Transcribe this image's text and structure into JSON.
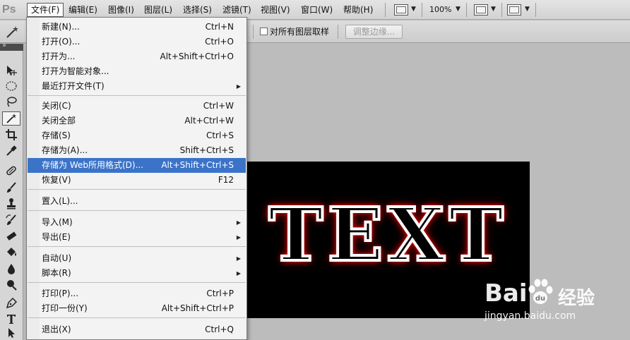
{
  "app": {
    "logo": "Ps"
  },
  "menubar": {
    "items": [
      {
        "label": "文件(F)"
      },
      {
        "label": "编辑(E)"
      },
      {
        "label": "图像(I)"
      },
      {
        "label": "图层(L)"
      },
      {
        "label": "选择(S)"
      },
      {
        "label": "滤镜(T)"
      },
      {
        "label": "视图(V)"
      },
      {
        "label": "窗口(W)"
      },
      {
        "label": "帮助(H)"
      }
    ],
    "zoom_level": "100%"
  },
  "options_bar": {
    "sample_all_layers_label": "对所有图层取样",
    "sample_all_layers_checked": false,
    "refine_edge_label": "调整边缘..."
  },
  "file_menu": {
    "items": [
      {
        "label": "新建(N)...",
        "shortcut": "Ctrl+N"
      },
      {
        "label": "打开(O)...",
        "shortcut": "Ctrl+O"
      },
      {
        "label": "打开为...",
        "shortcut": "Alt+Shift+Ctrl+O"
      },
      {
        "label": "打开为智能对象...",
        "shortcut": ""
      },
      {
        "label": "最近打开文件(T)",
        "shortcut": ""
      },
      {
        "label": "关闭(C)",
        "shortcut": "Ctrl+W"
      },
      {
        "label": "关闭全部",
        "shortcut": "Alt+Ctrl+W"
      },
      {
        "label": "存储(S)",
        "shortcut": "Ctrl+S"
      },
      {
        "label": "存储为(A)...",
        "shortcut": "Shift+Ctrl+S"
      },
      {
        "label": "存储为 Web所用格式(D)...",
        "shortcut": "Alt+Shift+Ctrl+S"
      },
      {
        "label": "恢复(V)",
        "shortcut": "F12"
      },
      {
        "label": "置入(L)...",
        "shortcut": ""
      },
      {
        "label": "导入(M)",
        "shortcut": ""
      },
      {
        "label": "导出(E)",
        "shortcut": ""
      },
      {
        "label": "自动(U)",
        "shortcut": ""
      },
      {
        "label": "脚本(R)",
        "shortcut": ""
      },
      {
        "label": "打印(P)...",
        "shortcut": "Ctrl+P"
      },
      {
        "label": "打印一份(Y)",
        "shortcut": "Alt+Shift+Ctrl+P"
      },
      {
        "label": "退出(X)",
        "shortcut": "Ctrl+Q"
      }
    ]
  },
  "document": {
    "text": "TEXT"
  },
  "watermark": {
    "brand": "Bai",
    "brand_cn": "经验",
    "site": "jingyan.baidu.com"
  },
  "colors": {
    "highlight": "#3b73c9",
    "glow": "#ff0000",
    "canvas_bg": "#bcbcbc"
  },
  "tools": [
    {
      "icon": "move-icon"
    },
    {
      "icon": "marquee-icon"
    },
    {
      "icon": "lasso-icon"
    },
    {
      "icon": "magic-wand-icon"
    },
    {
      "icon": "crop-icon"
    },
    {
      "icon": "eyedropper-icon"
    },
    {
      "icon": "healing-brush-icon"
    },
    {
      "icon": "brush-icon"
    },
    {
      "icon": "clone-stamp-icon"
    },
    {
      "icon": "history-brush-icon"
    },
    {
      "icon": "eraser-icon"
    },
    {
      "icon": "paint-bucket-icon"
    },
    {
      "icon": "blur-icon"
    },
    {
      "icon": "dodge-icon"
    },
    {
      "icon": "pen-icon"
    },
    {
      "icon": "type-icon"
    },
    {
      "icon": "path-selection-icon"
    }
  ]
}
